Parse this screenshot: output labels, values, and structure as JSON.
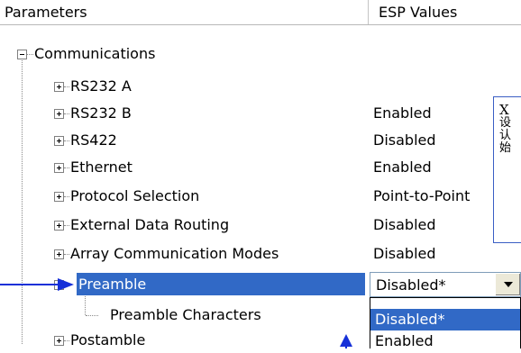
{
  "header": {
    "parameters_label": "Parameters",
    "esp_values_label": "ESP Values"
  },
  "tree": {
    "root_label": "Communications",
    "items": [
      {
        "label": "RS232 A",
        "value": ""
      },
      {
        "label": "RS232 B",
        "value": "Enabled"
      },
      {
        "label": "RS422",
        "value": "Disabled"
      },
      {
        "label": "Ethernet",
        "value": "Enabled"
      },
      {
        "label": "Protocol Selection",
        "value": "Point-to-Point"
      },
      {
        "label": "External Data Routing",
        "value": "Disabled"
      },
      {
        "label": "Array Communication Modes",
        "value": "Disabled"
      },
      {
        "label": "Preamble",
        "value": "Disabled*"
      },
      {
        "label": "Preamble Characters",
        "value": ""
      },
      {
        "label": "Postamble",
        "value": ""
      }
    ]
  },
  "combo": {
    "selected": "Disabled*",
    "options": [
      "Disabled*",
      "Enabled"
    ]
  },
  "tooltip": {
    "lines": [
      "X",
      "设",
      "认",
      "始"
    ]
  },
  "colors": {
    "selection": "#3169c6",
    "annotation_arrow": "#1630d8",
    "tooltip_border": "#3a5ec4"
  }
}
